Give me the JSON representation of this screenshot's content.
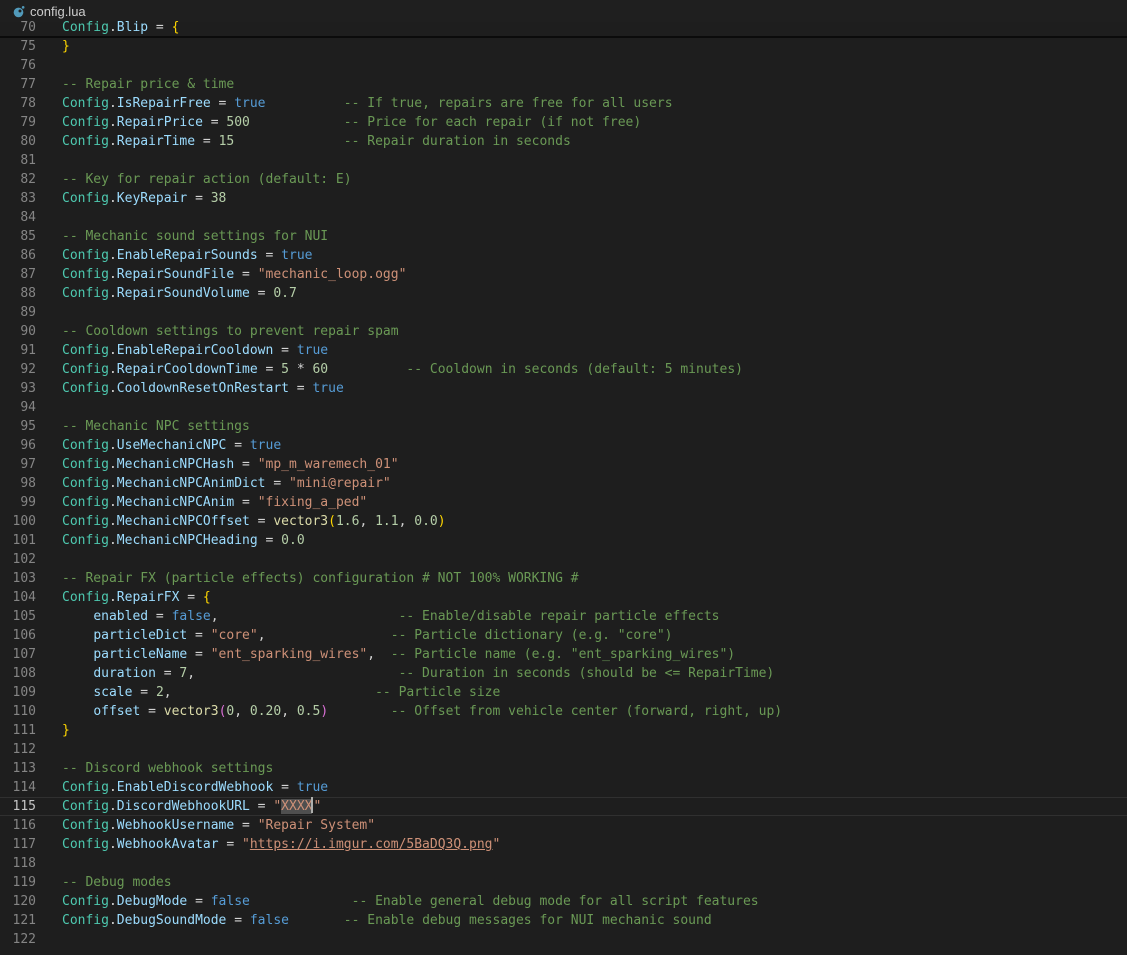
{
  "tab": {
    "filename": "config.lua",
    "icon": "lua-file-icon"
  },
  "editor": {
    "active_line": "115",
    "lines": [
      {
        "n": "70",
        "tokens": [
          [
            "t-cls",
            "Config"
          ],
          [
            "t-op",
            "."
          ],
          [
            "t-id",
            "Blip"
          ],
          [
            "t-op",
            " = "
          ],
          [
            "t-b1",
            "{"
          ]
        ]
      },
      {
        "n": "75",
        "tokens": [
          [
            "t-b1",
            "}"
          ]
        ]
      },
      {
        "n": "76",
        "tokens": []
      },
      {
        "n": "77",
        "tokens": [
          [
            "t-cmt",
            "-- Repair price & time"
          ]
        ]
      },
      {
        "n": "78",
        "tokens": [
          [
            "t-cls",
            "Config"
          ],
          [
            "t-op",
            "."
          ],
          [
            "t-id",
            "IsRepairFree"
          ],
          [
            "t-op",
            " = "
          ],
          [
            "t-kw",
            "true"
          ],
          [
            "t-op",
            "          "
          ],
          [
            "t-cmt",
            "-- If true, repairs are free for all users"
          ]
        ]
      },
      {
        "n": "79",
        "tokens": [
          [
            "t-cls",
            "Config"
          ],
          [
            "t-op",
            "."
          ],
          [
            "t-id",
            "RepairPrice"
          ],
          [
            "t-op",
            " = "
          ],
          [
            "t-num",
            "500"
          ],
          [
            "t-op",
            "            "
          ],
          [
            "t-cmt",
            "-- Price for each repair (if not free)"
          ]
        ]
      },
      {
        "n": "80",
        "tokens": [
          [
            "t-cls",
            "Config"
          ],
          [
            "t-op",
            "."
          ],
          [
            "t-id",
            "RepairTime"
          ],
          [
            "t-op",
            " = "
          ],
          [
            "t-num",
            "15"
          ],
          [
            "t-op",
            "              "
          ],
          [
            "t-cmt",
            "-- Repair duration in seconds"
          ]
        ]
      },
      {
        "n": "81",
        "tokens": []
      },
      {
        "n": "82",
        "tokens": [
          [
            "t-cmt",
            "-- Key for repair action (default: E)"
          ]
        ]
      },
      {
        "n": "83",
        "tokens": [
          [
            "t-cls",
            "Config"
          ],
          [
            "t-op",
            "."
          ],
          [
            "t-id",
            "KeyRepair"
          ],
          [
            "t-op",
            " = "
          ],
          [
            "t-num",
            "38"
          ]
        ]
      },
      {
        "n": "84",
        "tokens": []
      },
      {
        "n": "85",
        "tokens": [
          [
            "t-cmt",
            "-- Mechanic sound settings for NUI"
          ]
        ]
      },
      {
        "n": "86",
        "tokens": [
          [
            "t-cls",
            "Config"
          ],
          [
            "t-op",
            "."
          ],
          [
            "t-id",
            "EnableRepairSounds"
          ],
          [
            "t-op",
            " = "
          ],
          [
            "t-kw",
            "true"
          ]
        ]
      },
      {
        "n": "87",
        "tokens": [
          [
            "t-cls",
            "Config"
          ],
          [
            "t-op",
            "."
          ],
          [
            "t-id",
            "RepairSoundFile"
          ],
          [
            "t-op",
            " = "
          ],
          [
            "t-str",
            "\"mechanic_loop.ogg\""
          ]
        ]
      },
      {
        "n": "88",
        "tokens": [
          [
            "t-cls",
            "Config"
          ],
          [
            "t-op",
            "."
          ],
          [
            "t-id",
            "RepairSoundVolume"
          ],
          [
            "t-op",
            " = "
          ],
          [
            "t-num",
            "0.7"
          ]
        ]
      },
      {
        "n": "89",
        "tokens": []
      },
      {
        "n": "90",
        "tokens": [
          [
            "t-cmt",
            "-- Cooldown settings to prevent repair spam"
          ]
        ]
      },
      {
        "n": "91",
        "tokens": [
          [
            "t-cls",
            "Config"
          ],
          [
            "t-op",
            "."
          ],
          [
            "t-id",
            "EnableRepairCooldown"
          ],
          [
            "t-op",
            " = "
          ],
          [
            "t-kw",
            "true"
          ]
        ]
      },
      {
        "n": "92",
        "tokens": [
          [
            "t-cls",
            "Config"
          ],
          [
            "t-op",
            "."
          ],
          [
            "t-id",
            "RepairCooldownTime"
          ],
          [
            "t-op",
            " = "
          ],
          [
            "t-num",
            "5"
          ],
          [
            "t-op",
            " * "
          ],
          [
            "t-num",
            "60"
          ],
          [
            "t-op",
            "          "
          ],
          [
            "t-cmt",
            "-- Cooldown in seconds (default: 5 minutes)"
          ]
        ]
      },
      {
        "n": "93",
        "tokens": [
          [
            "t-cls",
            "Config"
          ],
          [
            "t-op",
            "."
          ],
          [
            "t-id",
            "CooldownResetOnRestart"
          ],
          [
            "t-op",
            " = "
          ],
          [
            "t-kw",
            "true"
          ]
        ]
      },
      {
        "n": "94",
        "tokens": []
      },
      {
        "n": "95",
        "tokens": [
          [
            "t-cmt",
            "-- Mechanic NPC settings"
          ]
        ]
      },
      {
        "n": "96",
        "tokens": [
          [
            "t-cls",
            "Config"
          ],
          [
            "t-op",
            "."
          ],
          [
            "t-id",
            "UseMechanicNPC"
          ],
          [
            "t-op",
            " = "
          ],
          [
            "t-kw",
            "true"
          ]
        ]
      },
      {
        "n": "97",
        "tokens": [
          [
            "t-cls",
            "Config"
          ],
          [
            "t-op",
            "."
          ],
          [
            "t-id",
            "MechanicNPCHash"
          ],
          [
            "t-op",
            " = "
          ],
          [
            "t-str",
            "\"mp_m_waremech_01\""
          ]
        ]
      },
      {
        "n": "98",
        "tokens": [
          [
            "t-cls",
            "Config"
          ],
          [
            "t-op",
            "."
          ],
          [
            "t-id",
            "MechanicNPCAnimDict"
          ],
          [
            "t-op",
            " = "
          ],
          [
            "t-str",
            "\"mini@repair\""
          ]
        ]
      },
      {
        "n": "99",
        "tokens": [
          [
            "t-cls",
            "Config"
          ],
          [
            "t-op",
            "."
          ],
          [
            "t-id",
            "MechanicNPCAnim"
          ],
          [
            "t-op",
            " = "
          ],
          [
            "t-str",
            "\"fixing_a_ped\""
          ]
        ]
      },
      {
        "n": "100",
        "tokens": [
          [
            "t-cls",
            "Config"
          ],
          [
            "t-op",
            "."
          ],
          [
            "t-id",
            "MechanicNPCOffset"
          ],
          [
            "t-op",
            " = "
          ],
          [
            "t-fn",
            "vector3"
          ],
          [
            "t-b1",
            "("
          ],
          [
            "t-num",
            "1.6"
          ],
          [
            "t-op",
            ", "
          ],
          [
            "t-num",
            "1.1"
          ],
          [
            "t-op",
            ", "
          ],
          [
            "t-num",
            "0.0"
          ],
          [
            "t-b1",
            ")"
          ]
        ]
      },
      {
        "n": "101",
        "tokens": [
          [
            "t-cls",
            "Config"
          ],
          [
            "t-op",
            "."
          ],
          [
            "t-id",
            "MechanicNPCHeading"
          ],
          [
            "t-op",
            " = "
          ],
          [
            "t-num",
            "0.0"
          ]
        ]
      },
      {
        "n": "102",
        "tokens": []
      },
      {
        "n": "103",
        "tokens": [
          [
            "t-cmt",
            "-- Repair FX (particle effects) configuration # NOT 100% WORKING #"
          ]
        ]
      },
      {
        "n": "104",
        "tokens": [
          [
            "t-cls",
            "Config"
          ],
          [
            "t-op",
            "."
          ],
          [
            "t-id",
            "RepairFX"
          ],
          [
            "t-op",
            " = "
          ],
          [
            "t-b1",
            "{"
          ]
        ]
      },
      {
        "n": "105",
        "tokens": [
          [
            "t-op",
            "    "
          ],
          [
            "t-id",
            "enabled"
          ],
          [
            "t-op",
            " = "
          ],
          [
            "t-kw",
            "false"
          ],
          [
            "t-op",
            ",                       "
          ],
          [
            "t-cmt",
            "-- Enable/disable repair particle effects"
          ]
        ]
      },
      {
        "n": "106",
        "tokens": [
          [
            "t-op",
            "    "
          ],
          [
            "t-id",
            "particleDict"
          ],
          [
            "t-op",
            " = "
          ],
          [
            "t-str",
            "\"core\""
          ],
          [
            "t-op",
            ",                "
          ],
          [
            "t-cmt",
            "-- Particle dictionary (e.g. \"core\")"
          ]
        ]
      },
      {
        "n": "107",
        "tokens": [
          [
            "t-op",
            "    "
          ],
          [
            "t-id",
            "particleName"
          ],
          [
            "t-op",
            " = "
          ],
          [
            "t-str",
            "\"ent_sparking_wires\""
          ],
          [
            "t-op",
            ",  "
          ],
          [
            "t-cmt",
            "-- Particle name (e.g. \"ent_sparking_wires\")"
          ]
        ]
      },
      {
        "n": "108",
        "tokens": [
          [
            "t-op",
            "    "
          ],
          [
            "t-id",
            "duration"
          ],
          [
            "t-op",
            " = "
          ],
          [
            "t-num",
            "7"
          ],
          [
            "t-op",
            ",                          "
          ],
          [
            "t-cmt",
            "-- Duration in seconds (should be <= RepairTime)"
          ]
        ]
      },
      {
        "n": "109",
        "tokens": [
          [
            "t-op",
            "    "
          ],
          [
            "t-id",
            "scale"
          ],
          [
            "t-op",
            " = "
          ],
          [
            "t-num",
            "2"
          ],
          [
            "t-op",
            ",                          "
          ],
          [
            "t-cmt",
            "-- Particle size"
          ]
        ]
      },
      {
        "n": "110",
        "tokens": [
          [
            "t-op",
            "    "
          ],
          [
            "t-id",
            "offset"
          ],
          [
            "t-op",
            " = "
          ],
          [
            "t-fn",
            "vector3"
          ],
          [
            "t-b2",
            "("
          ],
          [
            "t-num",
            "0"
          ],
          [
            "t-op",
            ", "
          ],
          [
            "t-num",
            "0.20"
          ],
          [
            "t-op",
            ", "
          ],
          [
            "t-num",
            "0.5"
          ],
          [
            "t-b2",
            ")"
          ],
          [
            "t-op",
            "        "
          ],
          [
            "t-cmt",
            "-- Offset from vehicle center (forward, right, up)"
          ]
        ]
      },
      {
        "n": "111",
        "tokens": [
          [
            "t-b1",
            "}"
          ]
        ]
      },
      {
        "n": "112",
        "tokens": []
      },
      {
        "n": "113",
        "tokens": [
          [
            "t-cmt",
            "-- Discord webhook settings"
          ]
        ]
      },
      {
        "n": "114",
        "tokens": [
          [
            "t-cls",
            "Config"
          ],
          [
            "t-op",
            "."
          ],
          [
            "t-id",
            "EnableDiscordWebhook"
          ],
          [
            "t-op",
            " = "
          ],
          [
            "t-kw",
            "true"
          ]
        ]
      },
      {
        "n": "115",
        "tokens": [
          [
            "t-cls",
            "Config"
          ],
          [
            "t-op",
            "."
          ],
          [
            "t-id",
            "DiscordWebhookURL"
          ],
          [
            "t-op",
            " = "
          ],
          [
            "t-str",
            "\""
          ],
          [
            "t-str sel",
            "XXXX"
          ],
          [
            "caret",
            ""
          ],
          [
            "t-str",
            "\""
          ]
        ]
      },
      {
        "n": "116",
        "tokens": [
          [
            "t-cls",
            "Config"
          ],
          [
            "t-op",
            "."
          ],
          [
            "t-id",
            "WebhookUsername"
          ],
          [
            "t-op",
            " = "
          ],
          [
            "t-str",
            "\"Repair System\""
          ]
        ]
      },
      {
        "n": "117",
        "tokens": [
          [
            "t-cls",
            "Config"
          ],
          [
            "t-op",
            "."
          ],
          [
            "t-id",
            "WebhookAvatar"
          ],
          [
            "t-op",
            " = "
          ],
          [
            "t-str",
            "\""
          ],
          [
            "t-url",
            "https://i.imgur.com/5BaDQ3Q.png"
          ],
          [
            "t-str",
            "\""
          ]
        ]
      },
      {
        "n": "118",
        "tokens": []
      },
      {
        "n": "119",
        "tokens": [
          [
            "t-cmt",
            "-- Debug modes"
          ]
        ]
      },
      {
        "n": "120",
        "tokens": [
          [
            "t-cls",
            "Config"
          ],
          [
            "t-op",
            "."
          ],
          [
            "t-id",
            "DebugMode"
          ],
          [
            "t-op",
            " = "
          ],
          [
            "t-kw",
            "false"
          ],
          [
            "t-op",
            "             "
          ],
          [
            "t-cmt",
            "-- Enable general debug mode for all script features"
          ]
        ]
      },
      {
        "n": "121",
        "tokens": [
          [
            "t-cls",
            "Config"
          ],
          [
            "t-op",
            "."
          ],
          [
            "t-id",
            "DebugSoundMode"
          ],
          [
            "t-op",
            " = "
          ],
          [
            "t-kw",
            "false"
          ],
          [
            "t-op",
            "       "
          ],
          [
            "t-cmt",
            "-- Enable debug messages for NUI mechanic sound"
          ]
        ]
      },
      {
        "n": "122",
        "tokens": []
      }
    ]
  }
}
